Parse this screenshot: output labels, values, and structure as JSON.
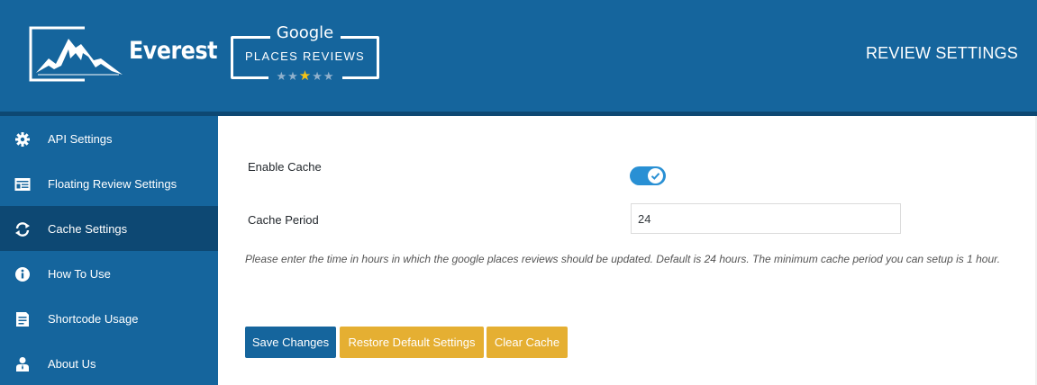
{
  "header": {
    "brand": "Everest",
    "badge_google": "Google",
    "badge_subtitle": "PLACES REVIEWS",
    "badge_stars": "★★★★★",
    "page_title": "REVIEW SETTINGS",
    "colors": {
      "primary": "#15659d",
      "dark": "#0d4873",
      "star_active": "#f3c316"
    }
  },
  "sidebar": {
    "items": [
      {
        "label": "API Settings",
        "icon": "gear-icon",
        "active": false
      },
      {
        "label": "Floating Review Settings",
        "icon": "layout-card-icon",
        "active": false
      },
      {
        "label": "Cache Settings",
        "icon": "refresh-icon",
        "active": true
      },
      {
        "label": "How To Use",
        "icon": "info-icon",
        "active": false
      },
      {
        "label": "Shortcode Usage",
        "icon": "document-icon",
        "active": false
      },
      {
        "label": "About Us",
        "icon": "user-icon",
        "active": false
      }
    ]
  },
  "form": {
    "enable_cache_label": "Enable Cache",
    "enable_cache_on": true,
    "cache_period_label": "Cache Period",
    "cache_period_value": "24",
    "help_text": "Please enter the time in hours in which the google places reviews should be updated. Default is 24 hours. The minimum cache period you can setup is 1 hour."
  },
  "actions": {
    "save": "Save Changes",
    "restore": "Restore Default Settings",
    "clear": "Clear Cache",
    "colors": {
      "save": "#15659d",
      "secondary": "#e5af32"
    }
  }
}
